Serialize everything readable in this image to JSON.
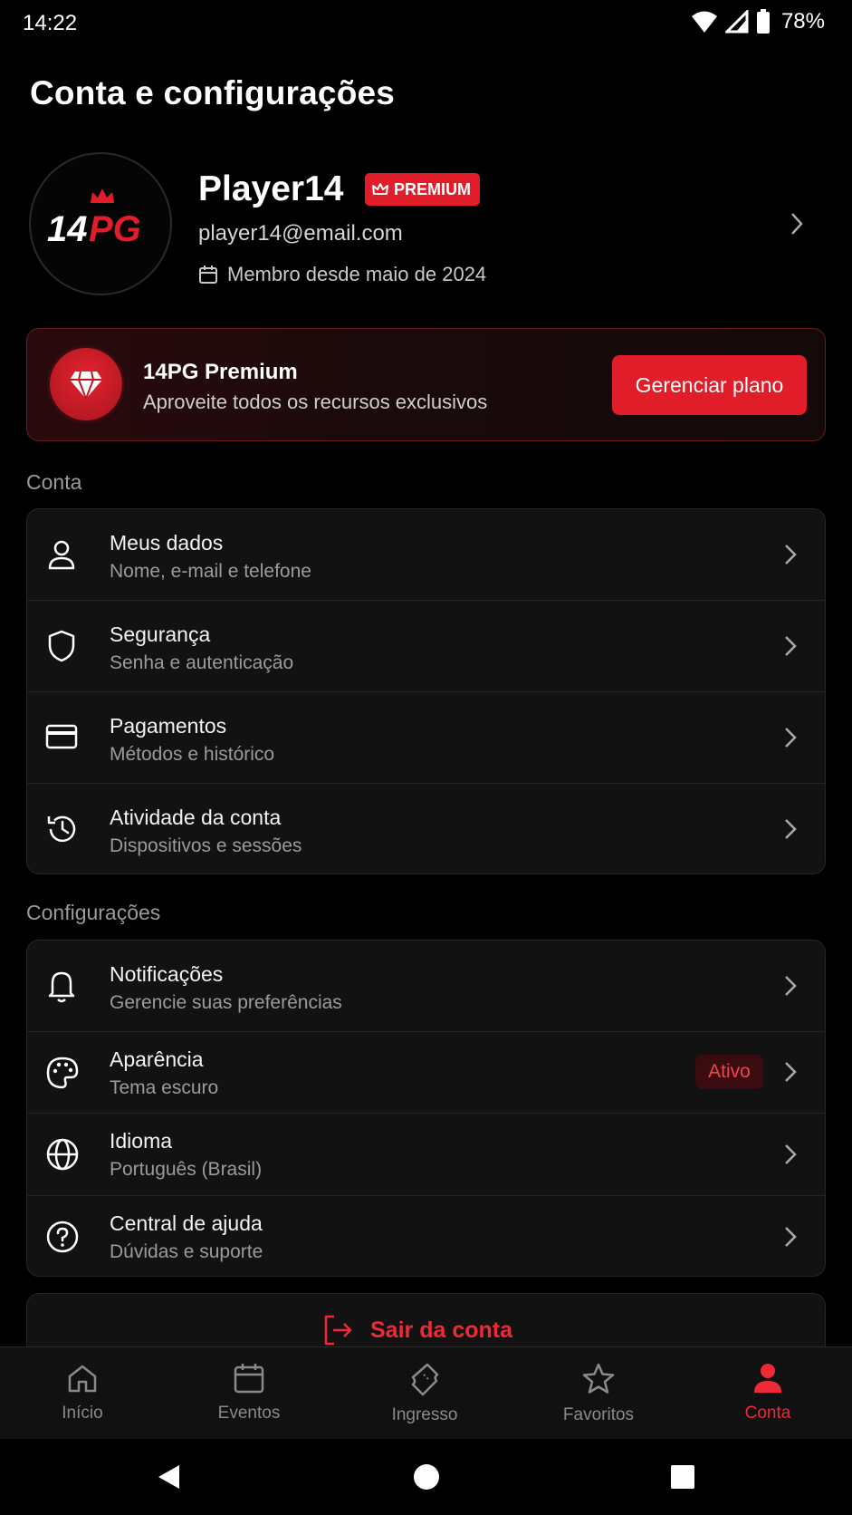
{
  "status_bar": {
    "time": "14:22",
    "battery": "78%"
  },
  "page": {
    "title": "Conta e configurações"
  },
  "profile": {
    "avatar_text": "14PG",
    "name": "Player14",
    "badge": "PREMIUM",
    "email": "player14@email.com",
    "member_since": "Membro desde maio de 2024"
  },
  "premium_card": {
    "title": "14PG Premium",
    "subtitle": "Aproveite todos os recursos exclusivos",
    "button": "Gerenciar plano"
  },
  "sections": {
    "conta": {
      "label": "Conta",
      "items": [
        {
          "title": "Meus dados",
          "subtitle": "Nome, e-mail e telefone",
          "icon": "user-icon"
        },
        {
          "title": "Segurança",
          "subtitle": "Senha e autenticação",
          "icon": "shield-icon"
        },
        {
          "title": "Pagamentos",
          "subtitle": "Métodos e histórico",
          "icon": "credit-card-icon"
        },
        {
          "title": "Atividade da conta",
          "subtitle": "Dispositivos e sessões",
          "icon": "history-icon"
        }
      ]
    },
    "configuracoes": {
      "label": "Configurações",
      "items": [
        {
          "title": "Notificações",
          "subtitle": "Gerencie suas preferências",
          "icon": "bell-icon"
        },
        {
          "title": "Aparência",
          "subtitle": "Tema escuro",
          "icon": "palette-icon",
          "badge": "Ativo"
        },
        {
          "title": "Idioma",
          "subtitle": "Português (Brasil)",
          "icon": "globe-icon"
        },
        {
          "title": "Central de ajuda",
          "subtitle": "Dúvidas e suporte",
          "icon": "help-circle-icon"
        }
      ]
    }
  },
  "logout": {
    "label": "Sair da conta"
  },
  "bottom_nav": {
    "items": [
      {
        "label": "Início",
        "icon": "home-icon"
      },
      {
        "label": "Eventos",
        "icon": "calendar-icon"
      },
      {
        "label": "Ingresso",
        "icon": "ticket-icon"
      },
      {
        "label": "Favoritos",
        "icon": "star-icon"
      },
      {
        "label": "Conta",
        "icon": "user-filled-icon",
        "active": true
      }
    ]
  },
  "colors": {
    "accent": "#e11d2a",
    "background": "#000000",
    "card": "#121212"
  }
}
